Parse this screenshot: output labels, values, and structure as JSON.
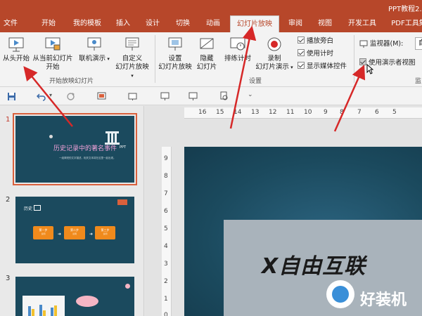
{
  "window": {
    "title": "PPT教程2.p"
  },
  "tabs": [
    {
      "label": "文件"
    },
    {
      "label": "开始"
    },
    {
      "label": "我的模板"
    },
    {
      "label": "插入"
    },
    {
      "label": "设计"
    },
    {
      "label": "切换"
    },
    {
      "label": "动画"
    },
    {
      "label": "幻灯片放映"
    },
    {
      "label": "审阅"
    },
    {
      "label": "视图"
    },
    {
      "label": "开发工具"
    },
    {
      "label": "PDF工具集"
    }
  ],
  "ribbon": {
    "from_start": "从头开始",
    "from_current_l1": "从当前幻灯片",
    "from_current_l2": "开始",
    "online_l1": "联机演示",
    "custom_l1": "自定义",
    "custom_l2": "幻灯片放映",
    "group_start": "开始放映幻灯片",
    "setup_l1": "设置",
    "setup_l2": "幻灯片放映",
    "hide_l1": "隐藏",
    "hide_l2": "幻灯片",
    "rehearse_l1": "排练计时",
    "record_l1": "录制",
    "record_l2": "幻灯片演示",
    "chk_narration": "播放旁白",
    "chk_timing": "使用计时",
    "chk_media": "显示媒体控件",
    "group_setup": "设置",
    "monitor_label": "监视器(M):",
    "monitor_value": "自动",
    "presenter_view": "使用演示者视图",
    "group_monitor": "监"
  },
  "ruler": {
    "h": [
      "16",
      "15",
      "14",
      "13",
      "12",
      "11",
      "10",
      "9",
      "8",
      "7",
      "6",
      "5"
    ],
    "v": [
      "9",
      "8",
      "7",
      "6",
      "5",
      "4",
      "3",
      "2",
      "1",
      "0"
    ]
  },
  "slides": [
    {
      "num": "1",
      "title": "历史记录中的著名事件",
      "tag": "PPT",
      "sub": "一组简短的文字描述，相关文本将在这里一起出现。"
    },
    {
      "num": "2",
      "heading": "历史",
      "steps": [
        "第一步",
        "第二步",
        "第三步"
      ],
      "step_sub": "说明"
    },
    {
      "num": "3"
    }
  ],
  "watermark": {
    "logo": "X自由互联",
    "site": "好装机"
  },
  "colors": {
    "accent": "#b7472a",
    "slide_bg": "#1b4a5e",
    "arrow": "#d62828",
    "step_orange": "#f08a1c"
  }
}
